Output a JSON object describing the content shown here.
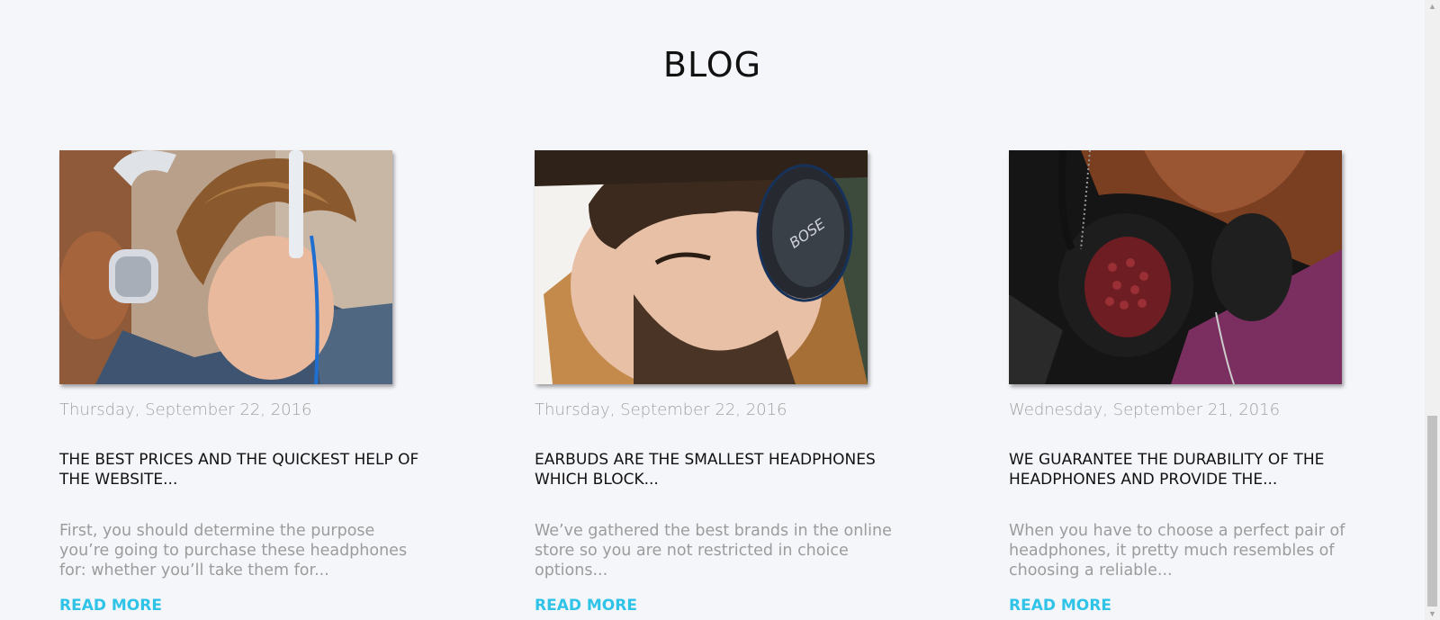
{
  "section": {
    "title": "BLOG"
  },
  "posts": [
    {
      "date": "Thursday, September 22, 2016",
      "title": "THE BEST PRICES AND THE QUICKEST HELP OF THE WEBSITE...",
      "excerpt": "First, you should determine the purpose you’re going to purchase these headphones for: whether you’ll take them for...",
      "link": "READ MORE",
      "image_icon": "man-with-white-headphones-photo"
    },
    {
      "date": "Thursday, September 22, 2016",
      "title": "EARBUDS ARE THE SMALLEST HEADPHONES WHICH BLOCK...",
      "excerpt": "We’ve gathered the best brands in the online store so you are not restricted in choice options...",
      "link": "READ MORE",
      "image_icon": "bearded-man-with-bose-headphones-photo",
      "brand_mark": "BOSE"
    },
    {
      "date": "Wednesday, September 21, 2016",
      "title": "WE GUARANTEE THE DURABILITY OF THE HEADPHONES AND PROVIDE THE...",
      "excerpt": "When you have to choose a perfect pair of headphones, it pretty much resembles of choosing a reliable...",
      "link": "READ MORE",
      "image_icon": "headphones-around-neck-photo"
    }
  ],
  "colors": {
    "background": "#f5f6fa",
    "accent": "#2fc3e8",
    "muted_text": "#a2a2a2",
    "heading_text": "#111111"
  }
}
